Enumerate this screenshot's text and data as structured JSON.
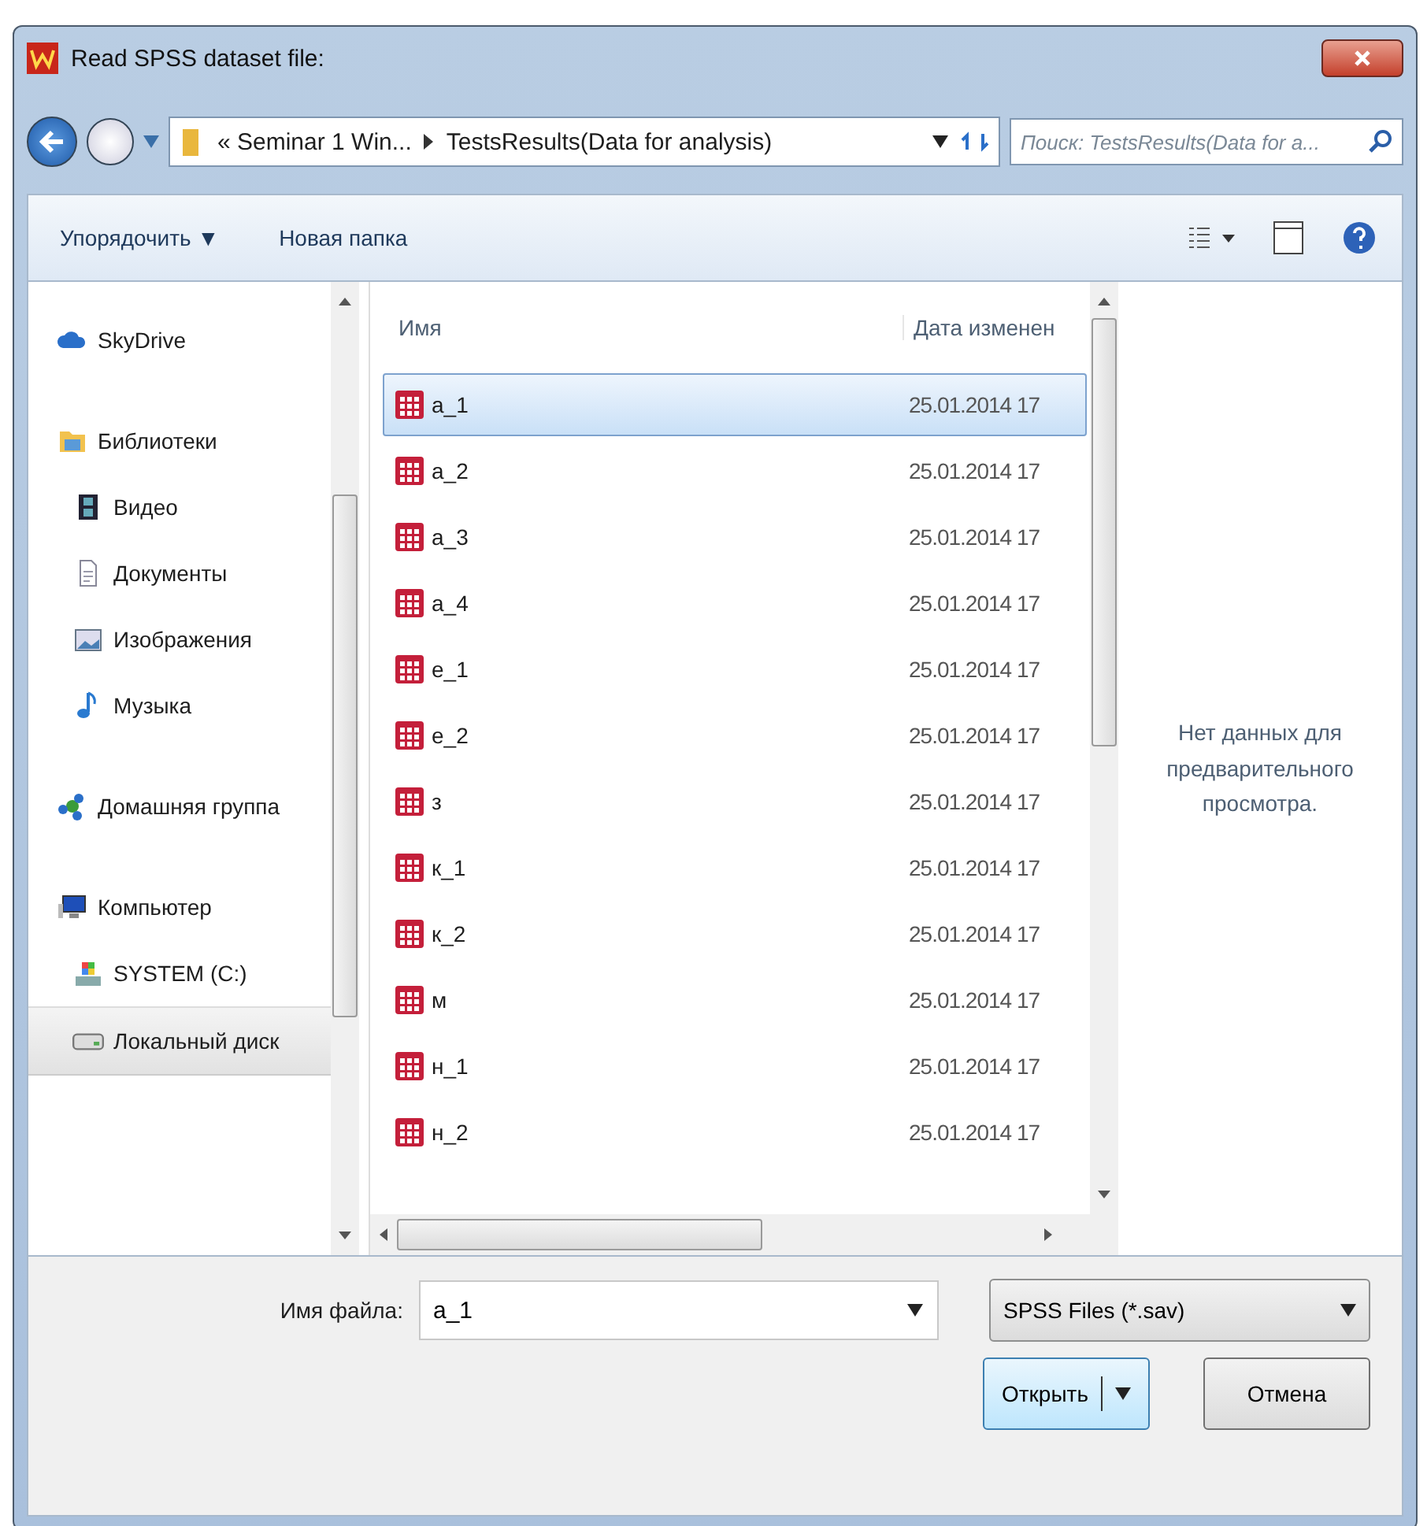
{
  "window": {
    "title": "Read SPSS dataset file:"
  },
  "address": {
    "path": [
      "« Seminar 1 Win...",
      "TestsResults(Data for analysis)"
    ]
  },
  "search": {
    "placeholder": "Поиск: TestsResults(Data for a..."
  },
  "toolbar": {
    "organize": "Упорядочить ▼",
    "new_folder": "Новая папка"
  },
  "sidebar": {
    "items": [
      {
        "label": "SkyDrive",
        "selected": false
      },
      {
        "label": "Библиотеки",
        "selected": false,
        "children": [
          {
            "label": "Видео",
            "selected": false
          },
          {
            "label": "Документы",
            "selected": false
          },
          {
            "label": "Изображения",
            "selected": false
          },
          {
            "label": "Музыка",
            "selected": false
          }
        ]
      },
      {
        "label": "Домашняя группа",
        "selected": false
      },
      {
        "label": "Компьютер",
        "selected": false,
        "children": [
          {
            "label": "SYSTEM (C:)",
            "selected": false
          },
          {
            "label": "Локальный диск",
            "selected": true
          }
        ]
      }
    ]
  },
  "table": {
    "columns": [
      "Имя",
      "Дата изменен"
    ],
    "rows": [
      {
        "name": "a_1",
        "date": "25.01.2014 17",
        "selected": true
      },
      {
        "name": "a_2",
        "date": "25.01.2014 17",
        "selected": false
      },
      {
        "name": "a_3",
        "date": "25.01.2014 17",
        "selected": false
      },
      {
        "name": "a_4",
        "date": "25.01.2014 17",
        "selected": false
      },
      {
        "name": "e_1",
        "date": "25.01.2014 17",
        "selected": false
      },
      {
        "name": "e_2",
        "date": "25.01.2014 17",
        "selected": false
      },
      {
        "name": "з",
        "date": "25.01.2014 17",
        "selected": false
      },
      {
        "name": "к_1",
        "date": "25.01.2014 17",
        "selected": false
      },
      {
        "name": "к_2",
        "date": "25.01.2014 17",
        "selected": false
      },
      {
        "name": "м",
        "date": "25.01.2014 17",
        "selected": false
      },
      {
        "name": "н_1",
        "date": "25.01.2014 17",
        "selected": false
      },
      {
        "name": "н_2",
        "date": "25.01.2014 17",
        "selected": false
      }
    ]
  },
  "preview": {
    "message": "Нет данных для предварительного просмотра."
  },
  "filename": {
    "label": "Имя файла:",
    "value": "a_1"
  },
  "filetype": {
    "value": "SPSS Files (*.sav)"
  },
  "buttons": {
    "open": "Открыть",
    "cancel": "Отмена"
  }
}
